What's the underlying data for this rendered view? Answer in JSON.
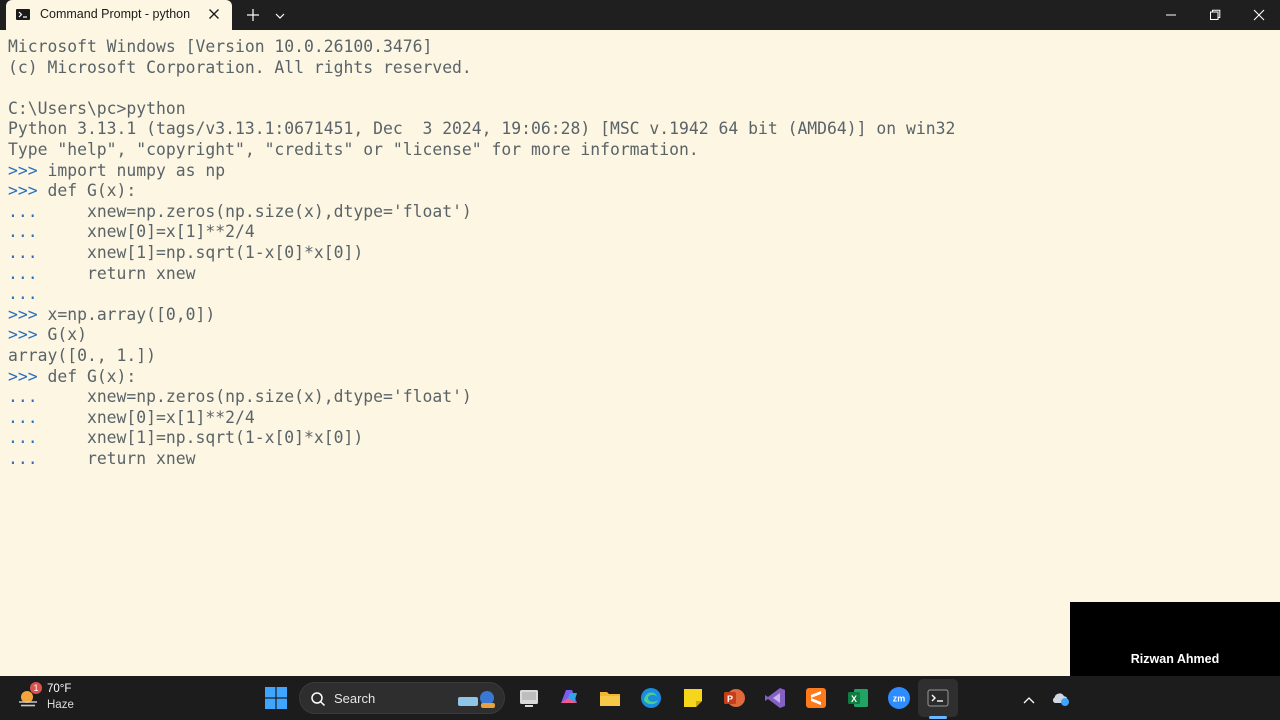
{
  "window": {
    "tab_title": "Command Prompt - python",
    "icons": {
      "tab": "terminal-icon",
      "close_tab": "close-icon",
      "new_tab": "plus-icon",
      "menu": "chevron-down-icon",
      "minimize": "minimize-icon",
      "maximize": "restore-icon",
      "close": "close-icon"
    }
  },
  "terminal": {
    "lines": [
      {
        "prompt": "",
        "text": "Microsoft Windows [Version 10.0.26100.3476]"
      },
      {
        "prompt": "",
        "text": "(c) Microsoft Corporation. All rights reserved."
      },
      {
        "prompt": "",
        "text": ""
      },
      {
        "prompt": "",
        "text": "C:\\Users\\pc>python"
      },
      {
        "prompt": "",
        "text": "Python 3.13.1 (tags/v3.13.1:0671451, Dec  3 2024, 19:06:28) [MSC v.1942 64 bit (AMD64)] on win32"
      },
      {
        "prompt": "",
        "text": "Type \"help\", \"copyright\", \"credits\" or \"license\" for more information."
      },
      {
        "prompt": ">>>",
        "text": " import numpy as np"
      },
      {
        "prompt": ">>>",
        "text": " def G(x):"
      },
      {
        "prompt": "...",
        "text": "     xnew=np.zeros(np.size(x),dtype='float')"
      },
      {
        "prompt": "...",
        "text": "     xnew[0]=x[1]**2/4"
      },
      {
        "prompt": "...",
        "text": "     xnew[1]=np.sqrt(1-x[0]*x[0])"
      },
      {
        "prompt": "...",
        "text": "     return xnew"
      },
      {
        "prompt": "...",
        "text": ""
      },
      {
        "prompt": ">>>",
        "text": " x=np.array([0,0])"
      },
      {
        "prompt": ">>>",
        "text": " G(x)"
      },
      {
        "prompt": "",
        "text": "array([0., 1.])"
      },
      {
        "prompt": ">>>",
        "text": " def G(x):"
      },
      {
        "prompt": "...",
        "text": "     xnew=np.zeros(np.size(x),dtype='float')"
      },
      {
        "prompt": "...",
        "text": "     xnew[0]=x[1]**2/4"
      },
      {
        "prompt": "...",
        "text": "     xnew[1]=np.sqrt(1-x[0]*x[0])"
      },
      {
        "prompt": "...",
        "text": "     return xnew"
      }
    ],
    "colors": {
      "background": "#fdf6e3",
      "text": "#5a6468",
      "prompt": "#2a6fbf"
    }
  },
  "overlay": {
    "name": "Rizwan Ahmed"
  },
  "taskbar": {
    "weather": {
      "badge": "1",
      "temp": "70°F",
      "condition": "Haze"
    },
    "search_label": "Search",
    "apps": [
      {
        "name": "file-explorer-icon"
      },
      {
        "name": "microsoft-365-icon"
      },
      {
        "name": "folder-icon"
      },
      {
        "name": "edge-icon"
      },
      {
        "name": "sticky-notes-icon"
      },
      {
        "name": "powerpoint-icon"
      },
      {
        "name": "visual-studio-icon"
      },
      {
        "name": "sublime-icon"
      },
      {
        "name": "excel-icon"
      },
      {
        "name": "zoom-icon"
      },
      {
        "name": "terminal-icon"
      }
    ]
  }
}
